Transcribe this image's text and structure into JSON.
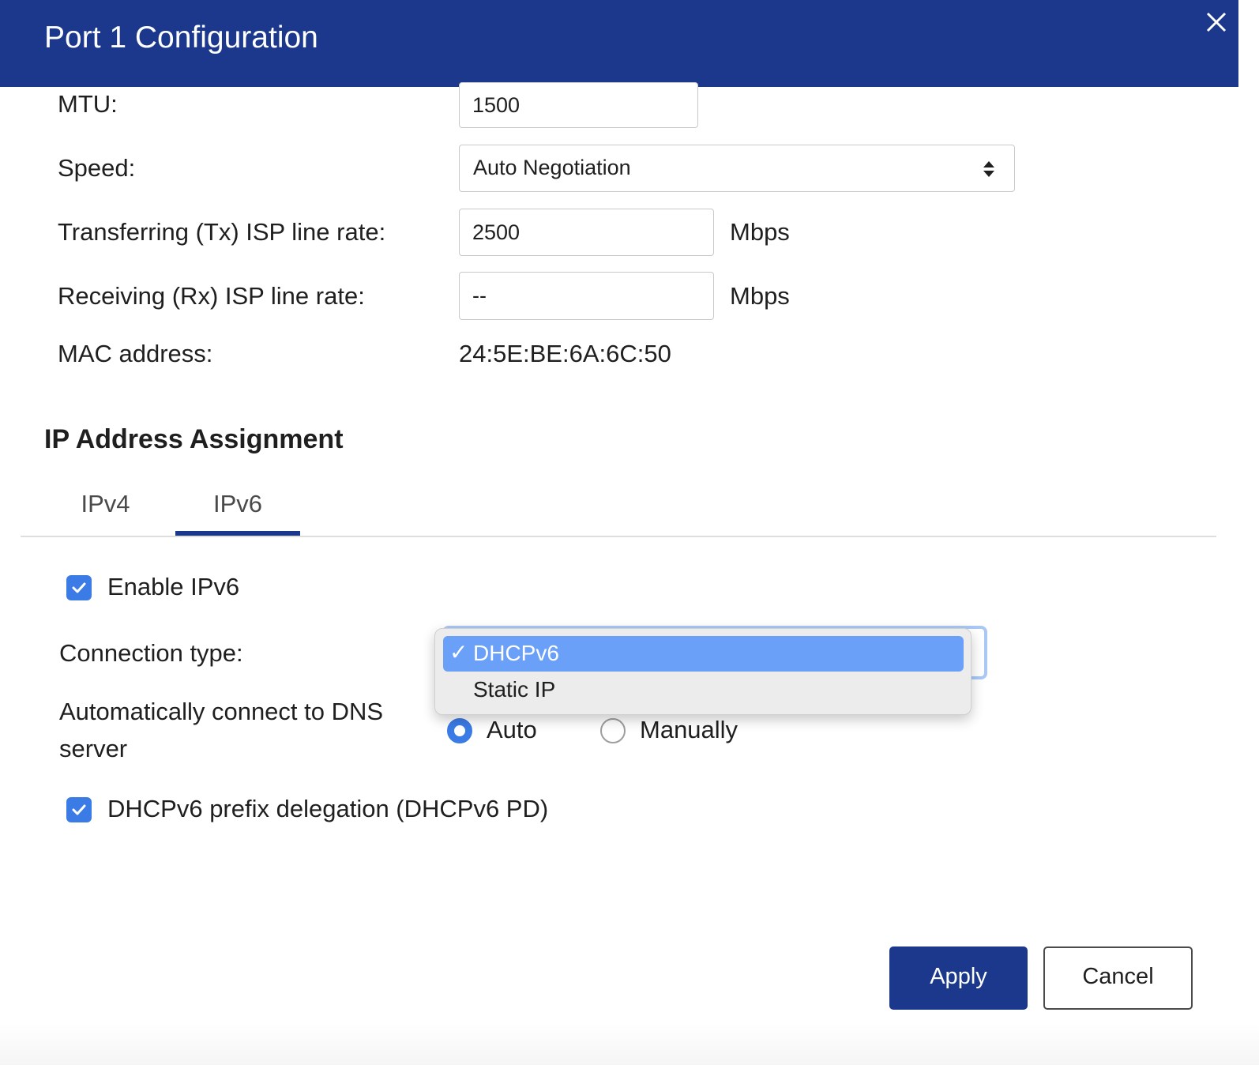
{
  "dialog": {
    "title": "Port 1 Configuration",
    "close_icon": "close-icon"
  },
  "port": {
    "mtu_label": "MTU:",
    "mtu_value": "1500",
    "speed_label": "Speed:",
    "speed_value": "Auto Negotiation",
    "tx_label": "Transferring (Tx) ISP line rate:",
    "tx_value": "2500",
    "tx_unit": "Mbps",
    "rx_label": "Receiving (Rx) ISP line rate:",
    "rx_value": "--",
    "rx_unit": "Mbps",
    "mac_label": "MAC address:",
    "mac_value": "24:5E:BE:6A:6C:50"
  },
  "ip_assignment": {
    "section_title": "IP Address Assignment",
    "tabs": [
      {
        "label": "IPv4",
        "active": false
      },
      {
        "label": "IPv6",
        "active": true
      }
    ],
    "enable_ipv6_label": "Enable IPv6",
    "enable_ipv6_checked": true,
    "connection_type_label": "Connection type:",
    "connection_type_options": [
      {
        "label": "DHCPv6",
        "selected": true,
        "check": "✓"
      },
      {
        "label": "Static IP",
        "selected": false
      }
    ],
    "dns_label_line1": "Automatically connect to DNS",
    "dns_label_line2": "server",
    "dns_options": [
      {
        "label": "Auto",
        "selected": true
      },
      {
        "label": "Manually",
        "selected": false
      }
    ],
    "prefix_delegation_label": "DHCPv6 prefix delegation (DHCPv6 PD)",
    "prefix_delegation_checked": true
  },
  "footer": {
    "apply_label": "Apply",
    "cancel_label": "Cancel"
  },
  "colors": {
    "header_bg": "#1b388c",
    "accent": "#3b7be6",
    "dropdown_highlight": "#6aa0f8"
  }
}
